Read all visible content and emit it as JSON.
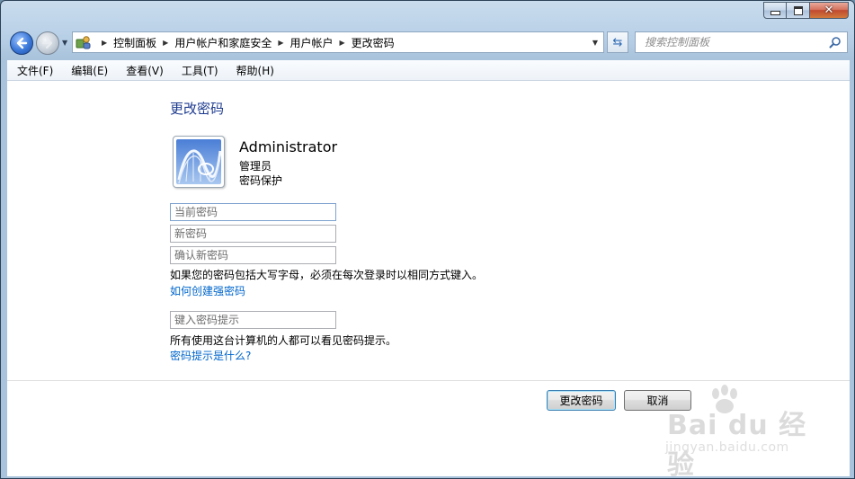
{
  "window": {
    "caption_buttons": [
      "minimize",
      "maximize",
      "close"
    ]
  },
  "nav": {
    "address": {
      "icon": "control-panel-icon",
      "crumbs": [
        "控制面板",
        "用户帐户和家庭安全",
        "用户帐户",
        "更改密码"
      ]
    },
    "search": {
      "placeholder": "搜索控制面板"
    }
  },
  "menu": {
    "items": [
      "文件(F)",
      "编辑(E)",
      "查看(V)",
      "工具(T)",
      "帮助(H)"
    ]
  },
  "page": {
    "title": "更改密码",
    "user": {
      "name": "Administrator",
      "role": "管理员",
      "status": "密码保护",
      "avatar_icon": "roller-coaster-avatar-icon"
    },
    "fields": {
      "current_password": {
        "placeholder": "当前密码",
        "value": ""
      },
      "new_password": {
        "placeholder": "新密码",
        "value": ""
      },
      "confirm_password": {
        "placeholder": "确认新密码",
        "value": ""
      },
      "hint": {
        "placeholder": "键入密码提示",
        "value": ""
      }
    },
    "caps_note": "如果您的密码包括大写字母，必须在每次登录时以相同方式键入。",
    "strong_password_link": "如何创建强密码",
    "hint_note": "所有使用这台计算机的人都可以看见密码提示。",
    "hint_link": "密码提示是什么?",
    "buttons": {
      "change": "更改密码",
      "cancel": "取消"
    }
  },
  "watermark": {
    "brand": "Bai du 经验",
    "url": "jingyan.baidu.com"
  },
  "colors": {
    "title_blue": "#1e3b8f",
    "link_blue": "#0066cc",
    "close_red": "#c04a2f"
  }
}
